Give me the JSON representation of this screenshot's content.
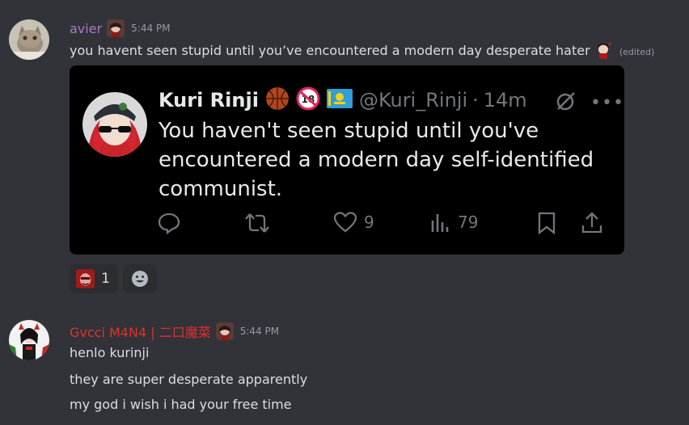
{
  "messages": [
    {
      "author": "avier",
      "author_color": "#a97ac4",
      "timestamp": "5:44 PM",
      "text": "you havent seen stupid until you’ve encountered a modern day desperate hater",
      "edited_label": "(edited)",
      "embed": {
        "name": "Kuri Rinji",
        "handle": "@Kuri_Rinji",
        "dot": "·",
        "time": "14m",
        "text": "You haven't seen stupid until you've encountered a modern day self-identified communist.",
        "likes": "9",
        "views": "79",
        "more": "•••"
      },
      "reactions": [
        {
          "emoji": "red-face-emoji",
          "count": "1"
        }
      ]
    },
    {
      "author": "Gvcci M4N4 | 二口魔菜",
      "author_color": "#e1302f",
      "timestamp": "5:44 PM",
      "lines": [
        "henlo kurinji",
        "they are super desperate apparently",
        "my god i wish i had your free time"
      ]
    }
  ],
  "icons": {
    "reply": "speech-bubble-icon",
    "retweet": "retweet-icon",
    "like": "heart-icon",
    "views": "bar-chart-icon",
    "bookmark": "bookmark-icon",
    "share": "share-icon",
    "grok": "slash-circle-icon",
    "add_reaction": "smiley-icon"
  }
}
